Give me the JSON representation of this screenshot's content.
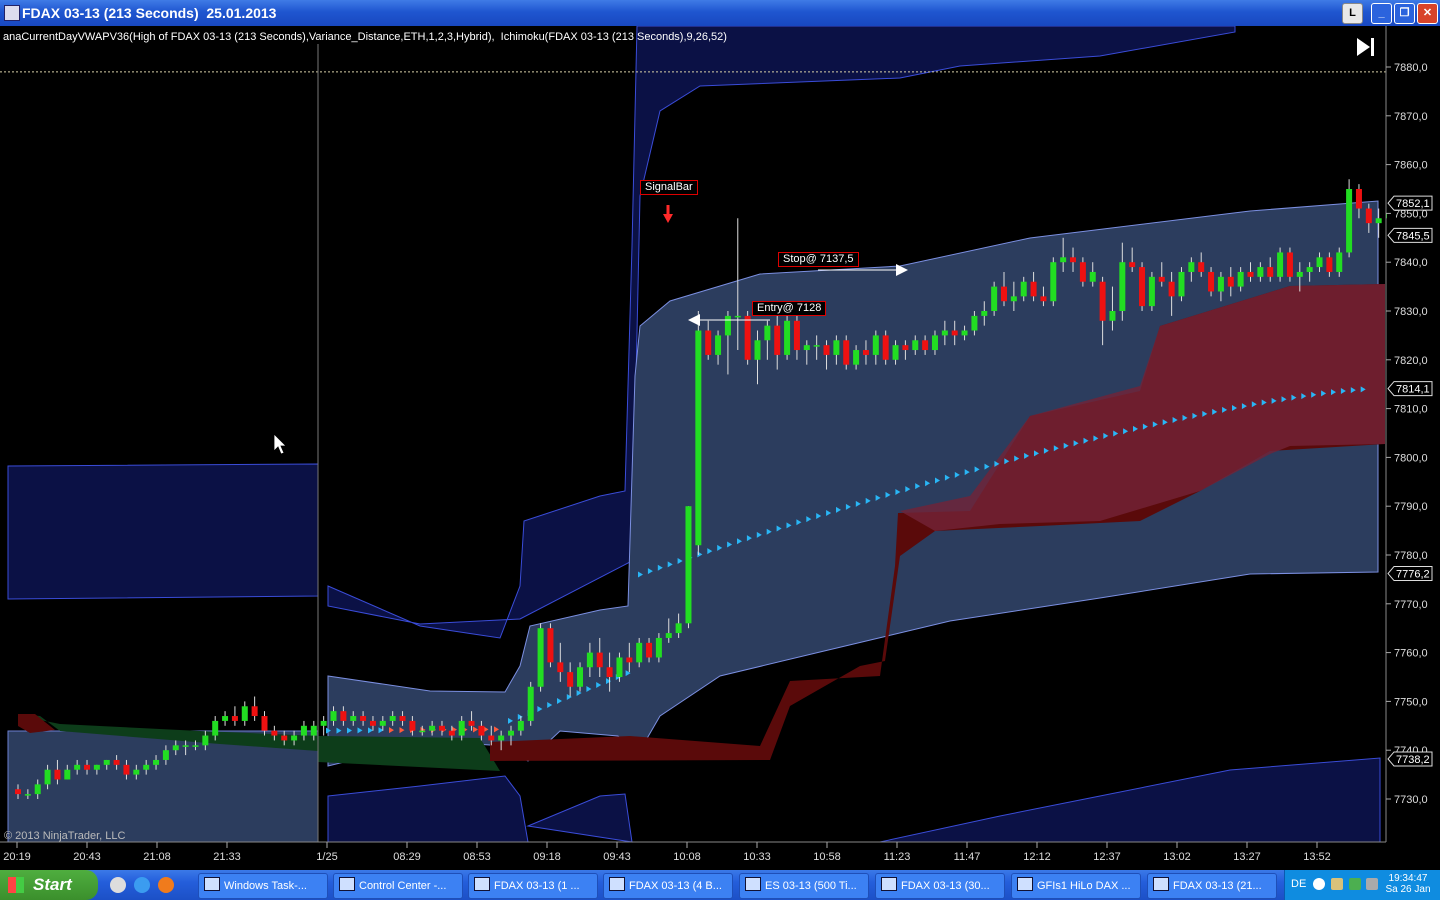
{
  "window": {
    "title": "FDAX 03-13 (213 Seconds)  25.01.2013",
    "btn_l": "L",
    "btn_min": "_",
    "btn_max": "❐",
    "btn_close": "✕"
  },
  "indicator_text": "anaCurrentDayVWAPV36(High of FDAX 03-13 (213 Seconds),Variance_Distance,ETH,1,2,3,Hybrid),  Ichimoku(FDAX 03-13 (213 Seconds),9,26,52)",
  "copyright": "© 2013 NinjaTrader, LLC",
  "annotations": {
    "signal": "SignalBar",
    "stop": "Stop@ 7137,5",
    "entry": "Entry@ 7128"
  },
  "colors": {
    "background": "#000000",
    "up_candle": "#22dd22",
    "down_candle": "#ee1111",
    "vwap_band": "#233a66",
    "outer_band": "#0b1145",
    "kumo_bear": "#5a0a0a",
    "kumo_bull": "#0d3d1a",
    "tenkan_markers": "#29b6f6"
  },
  "chart_data": {
    "type": "candlestick",
    "ylim": [
      7722,
      7887
    ],
    "y_ticks": [
      "7880,0",
      "7870,0",
      "7860,0",
      "7850,0",
      "7840,0",
      "7830,0",
      "7820,0",
      "7810,0",
      "7800,0",
      "7790,0",
      "7780,0",
      "7770,0",
      "7760,0",
      "7750,0",
      "7740,0",
      "7730,0"
    ],
    "x_ticks": [
      "20:19",
      "20:43",
      "21:08",
      "21:33",
      "1/25",
      "08:29",
      "08:53",
      "09:18",
      "09:43",
      "10:08",
      "10:33",
      "10:58",
      "11:23",
      "11:47",
      "12:12",
      "12:37",
      "13:02",
      "13:27",
      "13:52"
    ],
    "price_markers": [
      {
        "label": "7852,1",
        "value": 7852.1
      },
      {
        "label": "7845,5",
        "value": 7845.5
      },
      {
        "label": "7814,1",
        "value": 7814.1
      },
      {
        "label": "7776,2",
        "value": 7776.2
      },
      {
        "label": "7738,2",
        "value": 7738.2
      }
    ],
    "horizontal_line": 7879,
    "session_break_x": "1/25",
    "candles": [
      [
        7732,
        7733,
        7730,
        7731
      ],
      [
        7731,
        7732,
        7730,
        7731
      ],
      [
        7731,
        7734,
        7730,
        7733
      ],
      [
        7733,
        7737,
        7732,
        7736
      ],
      [
        7736,
        7738,
        7733,
        7734
      ],
      [
        7734,
        7737,
        7734,
        7736
      ],
      [
        7736,
        7738,
        7735,
        7737
      ],
      [
        7737,
        7738,
        7735,
        7736
      ],
      [
        7736,
        7737,
        7735,
        7737
      ],
      [
        7737,
        7738,
        7736,
        7738
      ],
      [
        7738,
        7739,
        7736,
        7737
      ],
      [
        7737,
        7738,
        7734,
        7735
      ],
      [
        7735,
        7737,
        7734,
        7736
      ],
      [
        7736,
        7738,
        7735,
        7737
      ],
      [
        7737,
        7739,
        7736,
        7738
      ],
      [
        7738,
        7741,
        7737,
        7740
      ],
      [
        7740,
        7742,
        7739,
        7741
      ],
      [
        7741,
        7742,
        7739,
        7741
      ],
      [
        7741,
        7742,
        7740,
        7741
      ],
      [
        7741,
        7744,
        7740,
        7743
      ],
      [
        7743,
        7747,
        7742,
        7746
      ],
      [
        7746,
        7748,
        7745,
        7747
      ],
      [
        7747,
        7749,
        7745,
        7746
      ],
      [
        7746,
        7750,
        7745,
        7749
      ],
      [
        7749,
        7751,
        7746,
        7747
      ],
      [
        7747,
        7748,
        7743,
        7744
      ],
      [
        7744,
        7745,
        7742,
        7743
      ],
      [
        7743,
        7744,
        7741,
        7742
      ],
      [
        7742,
        7744,
        7741,
        7743
      ],
      [
        7743,
        7746,
        7742,
        7745
      ],
      [
        7743,
        7746,
        7742,
        7745
      ],
      [
        7745,
        7747,
        7743,
        7746
      ],
      [
        7746,
        7749,
        7745,
        7748
      ],
      [
        7748,
        7749,
        7745,
        7746
      ],
      [
        7746,
        7748,
        7745,
        7747
      ],
      [
        7747,
        7748,
        7745,
        7746
      ],
      [
        7746,
        7747,
        7744,
        7745
      ],
      [
        7745,
        7747,
        7744,
        7746
      ],
      [
        7746,
        7748,
        7745,
        7747
      ],
      [
        7747,
        7748,
        7745,
        7746
      ],
      [
        7746,
        7747,
        7743,
        7744
      ],
      [
        7744,
        7745,
        7743,
        7744
      ],
      [
        7744,
        7746,
        7743,
        7745
      ],
      [
        7745,
        7746,
        7743,
        7744
      ],
      [
        7744,
        7745,
        7742,
        7743
      ],
      [
        7743,
        7747,
        7742,
        7746
      ],
      [
        7746,
        7748,
        7744,
        7745
      ],
      [
        7745,
        7746,
        7742,
        7743
      ],
      [
        7743,
        7745,
        7741,
        7742
      ],
      [
        7742,
        7744,
        7740,
        7743
      ],
      [
        7743,
        7745,
        7741,
        7744
      ],
      [
        7744,
        7747,
        7743,
        7746
      ],
      [
        7746,
        7754,
        7745,
        7753
      ],
      [
        7753,
        7766,
        7752,
        7765
      ],
      [
        7765,
        7766,
        7757,
        7758
      ],
      [
        7758,
        7762,
        7754,
        7756
      ],
      [
        7756,
        7758,
        7751,
        7753
      ],
      [
        7753,
        7758,
        7752,
        7757
      ],
      [
        7757,
        7762,
        7755,
        7760
      ],
      [
        7760,
        7763,
        7755,
        7757
      ],
      [
        7757,
        7760,
        7752,
        7755
      ],
      [
        7755,
        7760,
        7754,
        7759
      ],
      [
        7759,
        7762,
        7756,
        7758
      ],
      [
        7758,
        7763,
        7757,
        7762
      ],
      [
        7762,
        7763,
        7758,
        7759
      ],
      [
        7759,
        7764,
        7758,
        7763
      ],
      [
        7763,
        7767,
        7762,
        7764
      ],
      [
        7764,
        7768,
        7763,
        7766
      ],
      [
        7766,
        7790,
        7765,
        7790
      ],
      [
        7782,
        7830,
        7780,
        7826
      ],
      [
        7826,
        7828,
        7820,
        7821
      ],
      [
        7821,
        7826,
        7819,
        7825
      ],
      [
        7825,
        7830,
        7817,
        7829
      ],
      [
        7829,
        7849,
        7822,
        7829
      ],
      [
        7829,
        7830,
        7819,
        7820
      ],
      [
        7820,
        7826,
        7815,
        7824
      ],
      [
        7824,
        7828,
        7820,
        7827
      ],
      [
        7827,
        7829,
        7818,
        7821
      ],
      [
        7821,
        7829,
        7820,
        7828
      ],
      [
        7828,
        7830,
        7820,
        7822
      ],
      [
        7822,
        7824,
        7819,
        7823
      ],
      [
        7823,
        7825,
        7820,
        7823
      ],
      [
        7823,
        7824,
        7818,
        7821
      ],
      [
        7821,
        7825,
        7819,
        7824
      ],
      [
        7824,
        7825,
        7818,
        7819
      ],
      [
        7819,
        7823,
        7818,
        7822
      ],
      [
        7822,
        7824,
        7819,
        7821
      ],
      [
        7821,
        7826,
        7819,
        7825
      ],
      [
        7825,
        7826,
        7819,
        7820
      ],
      [
        7820,
        7824,
        7819,
        7823
      ],
      [
        7823,
        7824,
        7820,
        7822
      ],
      [
        7822,
        7825,
        7821,
        7824
      ],
      [
        7824,
        7825,
        7821,
        7822
      ],
      [
        7822,
        7826,
        7821,
        7825
      ],
      [
        7825,
        7828,
        7823,
        7826
      ],
      [
        7826,
        7828,
        7823,
        7825
      ],
      [
        7825,
        7827,
        7824,
        7826
      ],
      [
        7826,
        7830,
        7825,
        7829
      ],
      [
        7829,
        7832,
        7827,
        7830
      ],
      [
        7830,
        7836,
        7829,
        7835
      ],
      [
        7835,
        7838,
        7831,
        7832
      ],
      [
        7832,
        7836,
        7830,
        7833
      ],
      [
        7833,
        7837,
        7832,
        7836
      ],
      [
        7836,
        7838,
        7832,
        7833
      ],
      [
        7833,
        7835,
        7831,
        7832
      ],
      [
        7832,
        7841,
        7831,
        7840
      ],
      [
        7840,
        7845,
        7838,
        7841
      ],
      [
        7841,
        7843,
        7838,
        7840
      ],
      [
        7840,
        7841,
        7835,
        7836
      ],
      [
        7836,
        7840,
        7835,
        7838
      ],
      [
        7836,
        7837,
        7823,
        7828
      ],
      [
        7828,
        7835,
        7826,
        7830
      ],
      [
        7830,
        7844,
        7828,
        7840
      ],
      [
        7840,
        7843,
        7838,
        7839
      ],
      [
        7839,
        7840,
        7830,
        7831
      ],
      [
        7831,
        7838,
        7830,
        7837
      ],
      [
        7837,
        7840,
        7835,
        7836
      ],
      [
        7836,
        7838,
        7829,
        7833
      ],
      [
        7833,
        7839,
        7832,
        7838
      ],
      [
        7838,
        7841,
        7836,
        7840
      ],
      [
        7840,
        7842,
        7837,
        7838
      ],
      [
        7838,
        7839,
        7833,
        7834
      ],
      [
        7834,
        7838,
        7832,
        7837
      ],
      [
        7837,
        7839,
        7833,
        7835
      ],
      [
        7835,
        7839,
        7834,
        7838
      ],
      [
        7838,
        7840,
        7836,
        7837
      ],
      [
        7837,
        7840,
        7836,
        7839
      ],
      [
        7839,
        7841,
        7836,
        7837
      ],
      [
        7837,
        7843,
        7836,
        7842
      ],
      [
        7842,
        7843,
        7836,
        7837
      ],
      [
        7837,
        7840,
        7834,
        7838
      ],
      [
        7838,
        7840,
        7836,
        7839
      ],
      [
        7839,
        7842,
        7838,
        7841
      ],
      [
        7841,
        7842,
        7837,
        7838
      ],
      [
        7838,
        7843,
        7837,
        7842
      ],
      [
        7842,
        7857,
        7841,
        7855
      ],
      [
        7855,
        7856,
        7849,
        7851
      ],
      [
        7851,
        7852,
        7846,
        7848
      ],
      [
        7848,
        7851,
        7845,
        7849
      ],
      [
        7849,
        7852,
        7847,
        7850
      ],
      [
        7850,
        7853,
        7848,
        7852
      ],
      [
        7852,
        7855,
        7849,
        7851
      ],
      [
        7851,
        7852,
        7848,
        7849
      ],
      [
        7849,
        7852,
        7847,
        7850
      ],
      [
        7850,
        7852,
        7848,
        7851
      ],
      [
        7851,
        7853,
        7849,
        7852
      ],
      [
        7852,
        7853,
        7848,
        7849
      ],
      [
        7849,
        7852,
        7847,
        7850
      ],
      [
        7848,
        7849,
        7845,
        7846
      ]
    ]
  },
  "taskbar": {
    "start": "Start",
    "tasks": [
      "Windows Task-...",
      "Control Center -...",
      "FDAX 03-13 (1 ...",
      "FDAX 03-13 (4 B...",
      "ES 03-13 (500 Ti...",
      "FDAX 03-13 (30...",
      "GFIs1 HiLo DAX ...",
      "FDAX 03-13 (21..."
    ],
    "lang": "DE",
    "time": "19:34:47",
    "date": "Sa 26 Jan"
  }
}
